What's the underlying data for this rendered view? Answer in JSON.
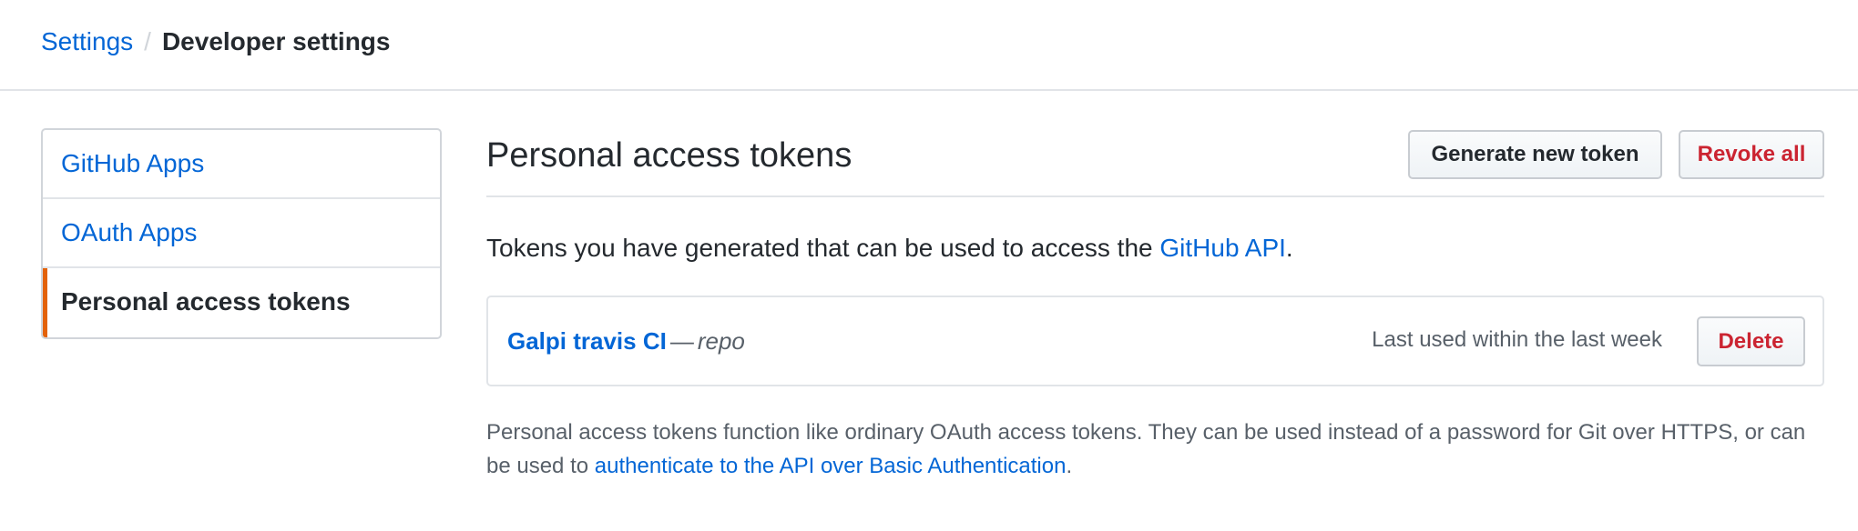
{
  "breadcrumb": {
    "parent": "Settings",
    "separator": "/",
    "current": "Developer settings"
  },
  "sidebar": {
    "items": [
      {
        "label": "GitHub Apps",
        "selected": false
      },
      {
        "label": "OAuth Apps",
        "selected": false
      },
      {
        "label": "Personal access tokens",
        "selected": true
      }
    ],
    "selected_accent": "#e36209"
  },
  "main": {
    "title": "Personal access tokens",
    "generate_button": "Generate new token",
    "revoke_all_button": "Revoke all",
    "description_prefix": "Tokens you have generated that can be used to access the ",
    "description_link": "GitHub API",
    "description_suffix": ".",
    "tokens": [
      {
        "name": "Galpi travis CI",
        "separator": "—",
        "scope": "repo",
        "last_used": "Last used within the last week",
        "delete_button": "Delete"
      }
    ],
    "note_text": "Personal access tokens function like ordinary OAuth access tokens. They can be used instead of a password for Git over HTTPS, or can be used to ",
    "note_link": "authenticate to the API over Basic Authentication",
    "note_suffix": "."
  },
  "colors": {
    "link": "#0366d6",
    "danger": "#cb2431",
    "text": "#24292e",
    "muted": "#586069",
    "border": "#e1e4e8"
  }
}
